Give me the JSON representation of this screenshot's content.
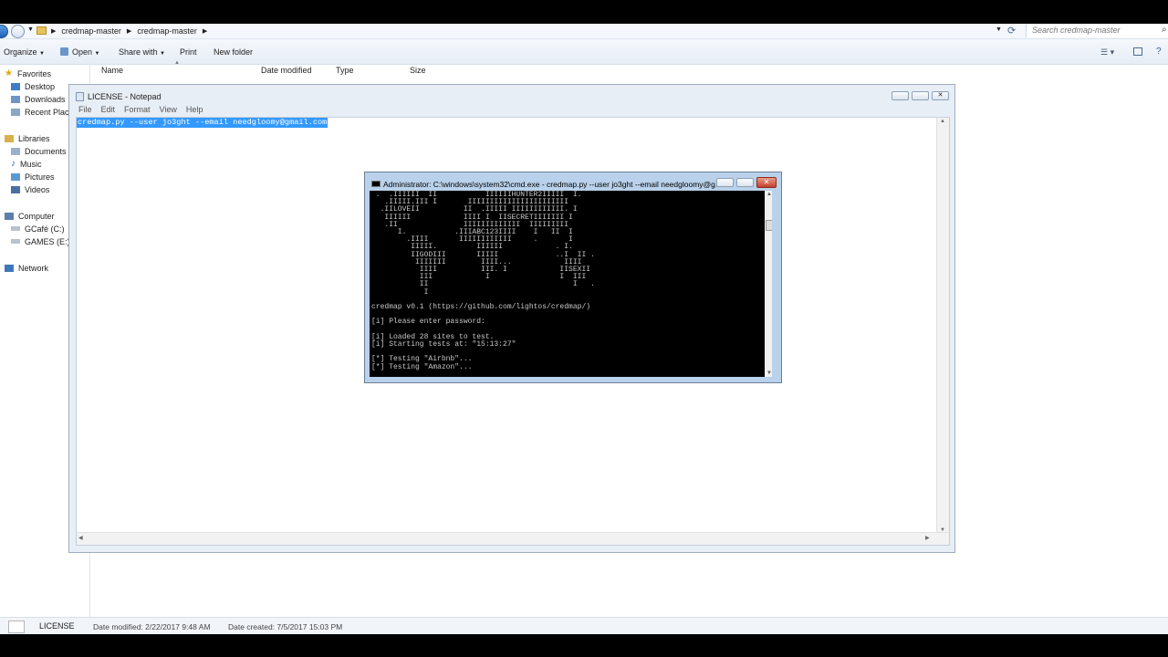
{
  "explorer": {
    "path": [
      "credmap-master",
      "credmap-master"
    ],
    "search_placeholder": "Search credmap-master",
    "toolbar": {
      "organize": "Organize",
      "open": "Open",
      "share_with": "Share with",
      "print": "Print",
      "new_folder": "New folder"
    },
    "sidebar": {
      "favorites": "Favorites",
      "favorites_items": [
        "Desktop",
        "Downloads",
        "Recent Places"
      ],
      "libraries": "Libraries",
      "libraries_items": [
        "Documents",
        "Music",
        "Pictures",
        "Videos"
      ],
      "computer": "Computer",
      "computer_items": [
        "GCafé (C:)",
        "GAMES (E:)"
      ],
      "network": "Network"
    },
    "columns": {
      "name": "Name",
      "date_modified": "Date modified",
      "type": "Type",
      "size": "Size"
    },
    "status": {
      "filename": "LICENSE",
      "date_modified": "Date modified: 2/22/2017 9:48 AM",
      "date_created": "Date created: 7/5/2017 15:03 PM"
    }
  },
  "notepad": {
    "title": "LICENSE - Notepad",
    "menu": [
      "File",
      "Edit",
      "Format",
      "View",
      "Help"
    ],
    "content": "credmap.py --user jo3ght --email needgloomy@gmail.com"
  },
  "cmd": {
    "title": "Administrator: C:\\windows\\system32\\cmd.exe - credmap.py  --user jo3ght --email needgloomy@g...",
    "output": " .  .IIIIII  II           IIIIIIHUNTER2IIIII  I.\n   .IIIII.III I       IIIIIIIIIIIIIIIIIIIIIII\n  .IILOVEII          II  .IIIII IIIIIIIIIIII. I\n   IIIIII            IIII I  IISECRETIIIIIII I\n   .II               IIIIIIIIIIIII  IIIIIIIII\n      I.           .IIIABC123IIII    I   II  I\n        .IIII       IIIIIIIIIIII     .       I\n         IIIII.         IIIIII            . I.\n         IIGODIII       IIIII             ..I  II .\n          IIIIIII        IIII...            IIII\n           IIII          III. I            IISEXII\n           III            I                I  III\n           II                                 I   .\n            I\n\ncredmap v0.1 (https://github.com/lightos/credmap/)\n\n[i] Please enter password:\n\n[i] Loaded 28 sites to test.\n[i] Starting tests at: \"15:13:27\"\n\n[*] Testing \"Airbnb\"...\n[*] Testing \"Amazon\"..."
  }
}
